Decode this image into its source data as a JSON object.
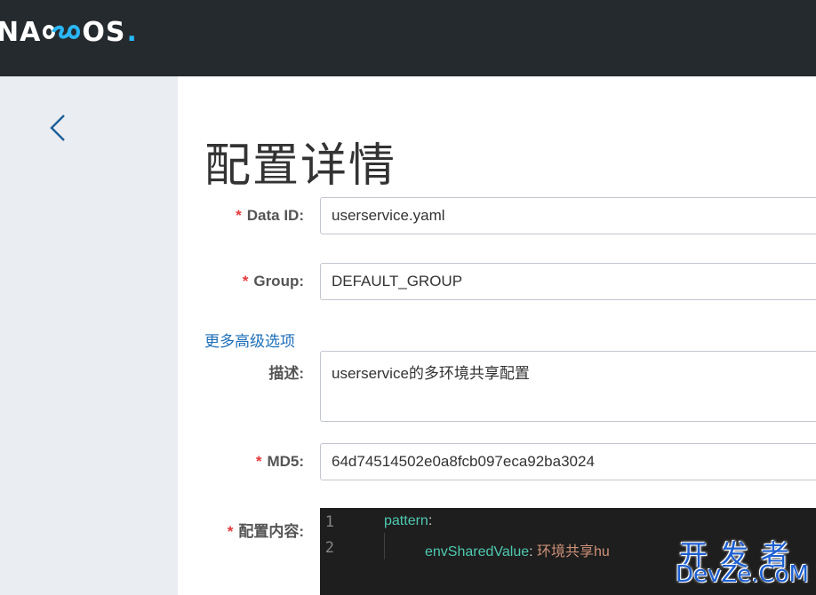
{
  "header": {
    "logo": {
      "part1": "NA",
      "part2": "OS",
      "dot": ".",
      "accent_color": "#2ab6f6"
    }
  },
  "nav": {
    "back_icon": "chevron-left-icon"
  },
  "page": {
    "title": "配置详情"
  },
  "form": {
    "data_id": {
      "label": "Data ID:",
      "required": "*",
      "value": "userservice.yaml"
    },
    "group": {
      "label": "Group:",
      "required": "*",
      "value": "DEFAULT_GROUP"
    },
    "more_options": "更多高级选项",
    "description": {
      "label": "描述:",
      "value": "userservice的多环境共享配置"
    },
    "md5": {
      "label": "MD5:",
      "required": "*",
      "value": "64d74514502e0a8fcb097eca92ba3024"
    },
    "content": {
      "label": "配置内容:",
      "required": "*",
      "lines": [
        {
          "number": "1",
          "key": "pattern",
          "colon": ":",
          "value": ""
        },
        {
          "number": "2",
          "key": "envSharedValue",
          "colon": ":",
          "value": "环境共享hu"
        }
      ]
    }
  },
  "watermark": {
    "line1": "开发者",
    "line2": "DevZe.CoM",
    "color": "#1d5fd1"
  },
  "colors": {
    "topbar": "#252a2f",
    "sidebar": "#eaedf1",
    "required": "#e4393c",
    "link": "#1d6fb8",
    "editor_bg": "#1e1e1e",
    "code_key": "#4ec9b0",
    "code_string": "#ce9178"
  }
}
